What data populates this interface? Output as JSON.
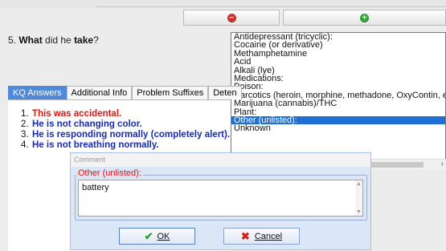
{
  "toolbar": {
    "prev_icon": "minus-circle-icon",
    "next_icon": "plus-circle-icon"
  },
  "question": {
    "number": "5.",
    "bold1": "What",
    "mid": " did he ",
    "bold2": "take",
    "end": "?"
  },
  "substance_list": {
    "options": [
      "Antidepressant (tricyclic):",
      "Cocaine (or derivative)",
      "Methamphetamine",
      "Acid",
      "Alkali (lye)",
      "Medications:",
      "Poison:",
      "Narcotics (heroin, morphine, methadone, OxyContin, e",
      "Marijuana (cannabis)/THC",
      "Plant:",
      "Other (unlisted):",
      "Unknown"
    ],
    "selected": "Other (unlisted):"
  },
  "tabs": [
    "KQ Answers",
    "Additional Info",
    "Problem Suffixes",
    "Deten"
  ],
  "answers": [
    {
      "num": "1.",
      "text": "This was accidental."
    },
    {
      "num": "2.",
      "text": "He is not changing color."
    },
    {
      "num": "3.",
      "text": "He is responding normally (completely alert)."
    },
    {
      "num": "4.",
      "text": "He is not breathing normally."
    }
  ],
  "dialog": {
    "title": "Comment",
    "group_label": "Other (unlisted):",
    "comment_value": "battery",
    "ok_label": "OK",
    "cancel_label": "Cancel"
  },
  "colors": {
    "accent": "#4e8ad8",
    "selection": "#1f6fd1",
    "alert": "#e01010",
    "answer": "#1a2ab0"
  }
}
